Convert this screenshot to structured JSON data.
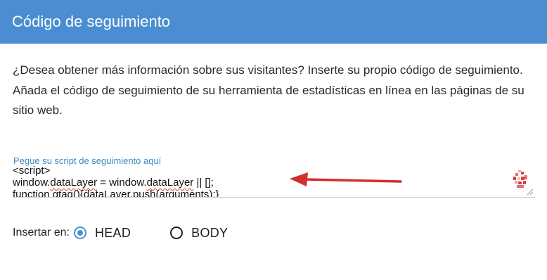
{
  "dialog": {
    "title": "Código de seguimiento"
  },
  "description": {
    "text": "¿Desea obtener más información sobre sus visitantes? Inserte su propio código de seguimiento. Añada el código de seguimiento de su herramienta de estadísticas en línea en las páginas de su sitio web."
  },
  "tracking_field": {
    "label": "Pegue su script de seguimiento aquí",
    "line1": "<script>",
    "line2_a": "window.",
    "line2_b": "dataLayer",
    "line2_c": " = window.",
    "line2_d": "dataLayer",
    "line2_e": " || [];",
    "line3": "function gtag(){dataLayer.push(arguments);}"
  },
  "insert": {
    "label": "Insertar en:",
    "options": [
      {
        "label": "HEAD",
        "selected": true
      },
      {
        "label": "BODY",
        "selected": false
      }
    ]
  },
  "colors": {
    "header": "#4a8ed1",
    "accent": "#3d8ac4",
    "arrow": "#d32f2f",
    "spellcheck": "#d83a3a"
  },
  "icons": {
    "recaptcha": "recaptcha-icon",
    "arrow": "arrow-left-icon",
    "resize": "resize-handle-icon"
  }
}
